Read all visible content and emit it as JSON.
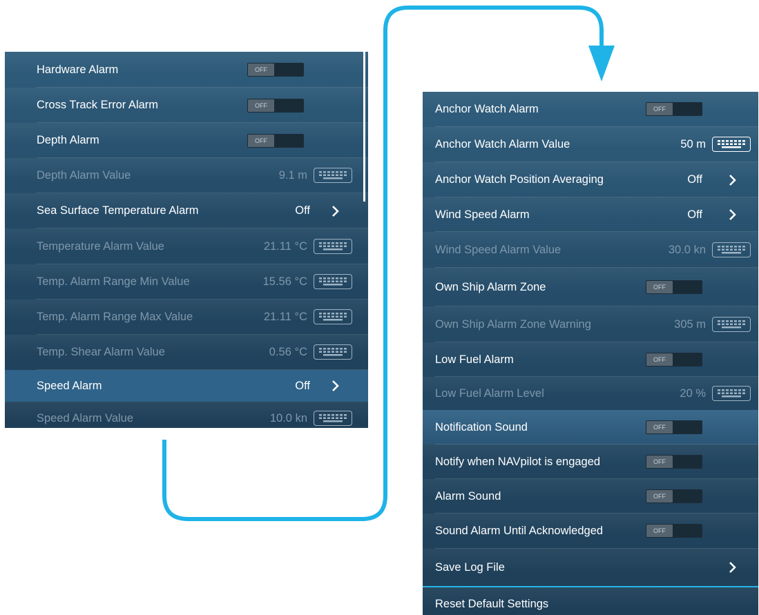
{
  "left_panel": {
    "rows": [
      {
        "label": "Hardware Alarm",
        "toggle": "OFF"
      },
      {
        "label": "Cross Track Error Alarm",
        "toggle": "OFF"
      },
      {
        "label": "Depth Alarm",
        "toggle": "OFF"
      },
      {
        "label": "Depth Alarm Value",
        "value": "9.1 m"
      },
      {
        "label": "Sea Surface Temperature Alarm",
        "value": "Off"
      },
      {
        "label": "Temperature Alarm Value",
        "value": "21.11 °C"
      },
      {
        "label": "Temp. Alarm Range Min Value",
        "value": "15.56 °C"
      },
      {
        "label": "Temp. Alarm Range Max Value",
        "value": "21.11 °C"
      },
      {
        "label": "Temp. Shear Alarm Value",
        "value": "0.56 °C"
      },
      {
        "label": "Speed Alarm",
        "value": "Off"
      },
      {
        "label": "Speed Alarm Value",
        "value": "10.0 kn"
      }
    ]
  },
  "right_panel": {
    "rows": [
      {
        "label": "Anchor Watch Alarm",
        "toggle": "OFF"
      },
      {
        "label": "Anchor Watch Alarm Value",
        "value": "50 m"
      },
      {
        "label": "Anchor Watch Position Averaging",
        "value": "Off"
      },
      {
        "label": "Wind Speed Alarm",
        "value": "Off"
      },
      {
        "label": "Wind Speed Alarm Value",
        "value": "30.0 kn"
      },
      {
        "label": "Own Ship Alarm Zone",
        "toggle": "OFF"
      },
      {
        "label": "Own Ship Alarm Zone Warning",
        "value": "305 m"
      },
      {
        "label": "Low Fuel Alarm",
        "toggle": "OFF"
      },
      {
        "label": "Low Fuel Alarm Level",
        "value": "20 %"
      },
      {
        "label": "Notification Sound",
        "toggle": "OFF"
      },
      {
        "label": "Notify when NAVpilot is engaged",
        "toggle": "OFF"
      },
      {
        "label": "Alarm Sound",
        "toggle": "OFF"
      },
      {
        "label": "Sound Alarm Until Acknowledged",
        "toggle": "OFF"
      },
      {
        "label": "Save Log File"
      },
      {
        "label": "Reset Default Settings"
      }
    ]
  },
  "colors": {
    "arrow": "#1fb3e8",
    "accent": "#25b6e6",
    "highlight": "#2f6389"
  }
}
